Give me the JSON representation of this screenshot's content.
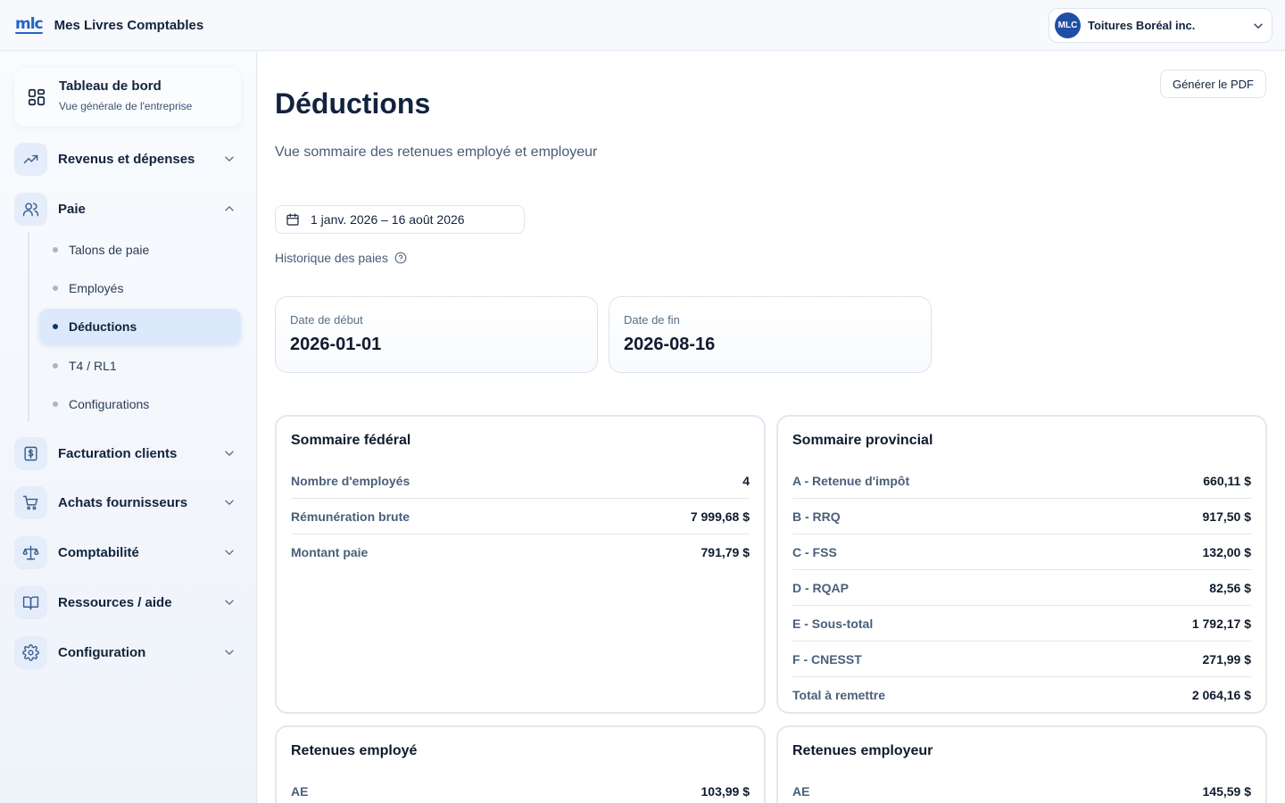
{
  "app": {
    "logo": "mlc",
    "name": "Mes Livres Comptables"
  },
  "company": {
    "initials": "MLC",
    "name": "Toitures Boréal inc."
  },
  "sidebar": {
    "dashboard": {
      "title": "Tableau de bord",
      "subtitle": "Vue générale de l'entreprise",
      "icon": "dashboard-grid-icon"
    },
    "items": [
      {
        "label": "Revenus et dépenses",
        "icon": "trending-up-icon",
        "expanded": false
      },
      {
        "label": "Paie",
        "icon": "users-icon",
        "expanded": true
      },
      {
        "label": "Facturation clients",
        "icon": "invoice-dollar-icon",
        "expanded": false
      },
      {
        "label": "Achats fournisseurs",
        "icon": "cart-icon",
        "expanded": false
      },
      {
        "label": "Comptabilité",
        "icon": "scale-icon",
        "expanded": false
      },
      {
        "label": "Ressources / aide",
        "icon": "book-icon",
        "expanded": false
      },
      {
        "label": "Configuration",
        "icon": "gear-icon",
        "expanded": false
      }
    ],
    "paie_subitems": [
      {
        "label": "Talons de paie",
        "active": false
      },
      {
        "label": "Employés",
        "active": false
      },
      {
        "label": "Déductions",
        "active": true
      },
      {
        "label": "T4 / RL1",
        "active": false
      },
      {
        "label": "Configurations",
        "active": false
      }
    ]
  },
  "main": {
    "pdf_button": "Générer le PDF",
    "title": "Déductions",
    "subtitle": "Vue sommaire des retenues employé et employeur",
    "date_range": "1 janv. 2026 – 16 août 2026",
    "history_label": "Historique des paies",
    "start": {
      "label": "Date de début",
      "value": "2026-01-01"
    },
    "end": {
      "label": "Date de fin",
      "value": "2026-08-16"
    },
    "federal": {
      "title": "Sommaire fédéral",
      "rows": [
        {
          "label": "Nombre d'employés",
          "value": "4"
        },
        {
          "label": "Rémunération brute",
          "value": "7 999,68 $"
        },
        {
          "label": "Montant paie",
          "value": "791,79 $"
        }
      ]
    },
    "provincial": {
      "title": "Sommaire provincial",
      "rows": [
        {
          "label": "A - Retenue d'impôt",
          "value": "660,11 $"
        },
        {
          "label": "B - RRQ",
          "value": "917,50 $"
        },
        {
          "label": "C - FSS",
          "value": "132,00 $"
        },
        {
          "label": "D - RQAP",
          "value": "82,56 $"
        },
        {
          "label": "E - Sous-total",
          "value": "1 792,17 $"
        },
        {
          "label": "F - CNESST",
          "value": "271,99 $"
        },
        {
          "label": "Total à remettre",
          "value": "2 064,16 $"
        }
      ]
    },
    "employee": {
      "title": "Retenues employé",
      "rows": [
        {
          "label": "AE",
          "value": "103,99 $"
        }
      ]
    },
    "employer": {
      "title": "Retenues employeur",
      "rows": [
        {
          "label": "AE",
          "value": "145,59 $"
        }
      ]
    }
  }
}
